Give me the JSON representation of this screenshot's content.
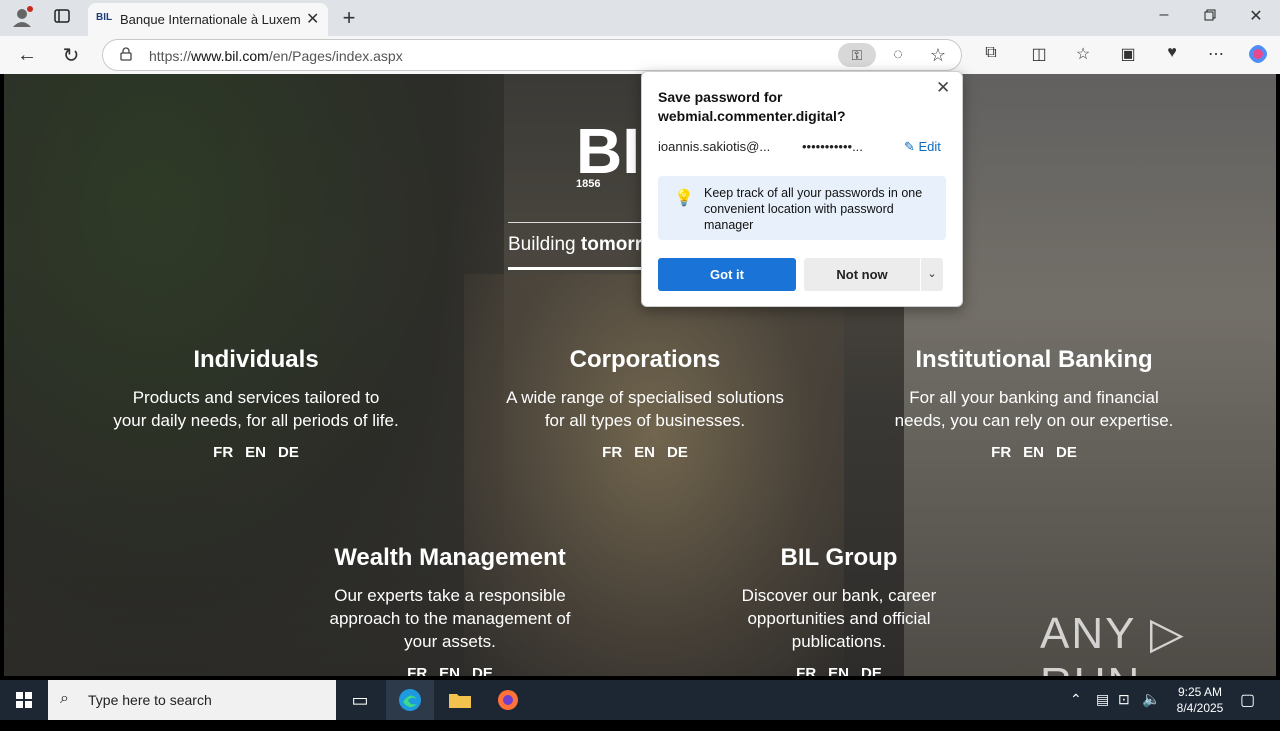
{
  "browser": {
    "tab_title": "Banque Internationale à Luxembourg",
    "tab_favicon": "BIL",
    "url_prefix": "https://",
    "url_domain": "www.bil.com",
    "url_path": "/en/Pages/index.aspx"
  },
  "page": {
    "logo": "BIL",
    "year": "1856",
    "tagline_light": "Building ",
    "tagline_bold": "tomorr",
    "sections": [
      {
        "title": "Individuals",
        "desc_1": "Products and services tailored to",
        "desc_2": "your daily needs, for all periods of life.",
        "langs": [
          "FR",
          "EN",
          "DE"
        ]
      },
      {
        "title": "Corporations",
        "desc_1": "A wide range of specialised solutions",
        "desc_2": "for all types of businesses.",
        "langs": [
          "FR",
          "EN",
          "DE"
        ]
      },
      {
        "title": "Institutional Banking",
        "desc_1": "For all your banking and financial",
        "desc_2": "needs, you can rely on our expertise.",
        "langs": [
          "FR",
          "EN",
          "DE"
        ]
      },
      {
        "title": "Wealth Management",
        "desc_1": "Our experts take a responsible",
        "desc_2": "approach to the management of",
        "desc_3": "your assets.",
        "langs": [
          "FR",
          "EN",
          "DE"
        ]
      },
      {
        "title": "BIL Group",
        "desc_1": "Discover our bank, career",
        "desc_2": "opportunities and official",
        "desc_3": "publications.",
        "langs": [
          "FR",
          "EN",
          "DE"
        ]
      }
    ],
    "watermark": "ANY ▷ RUN"
  },
  "popup": {
    "title": "Save password for webmial.commenter.digital?",
    "username": "ioannis.sakiotis@...",
    "password": "•••••••••••...",
    "edit_label": "Edit",
    "tip": "Keep track of all your passwords in one convenient location with password manager",
    "got_it": "Got it",
    "not_now": "Not now"
  },
  "taskbar": {
    "search_placeholder": "Type here to search",
    "time": "9:25 AM",
    "date": "8/4/2025"
  },
  "colors": {
    "accent": "#1a73d6",
    "taskbar": "#1c2733",
    "tip_bg": "#e8f1fb"
  }
}
